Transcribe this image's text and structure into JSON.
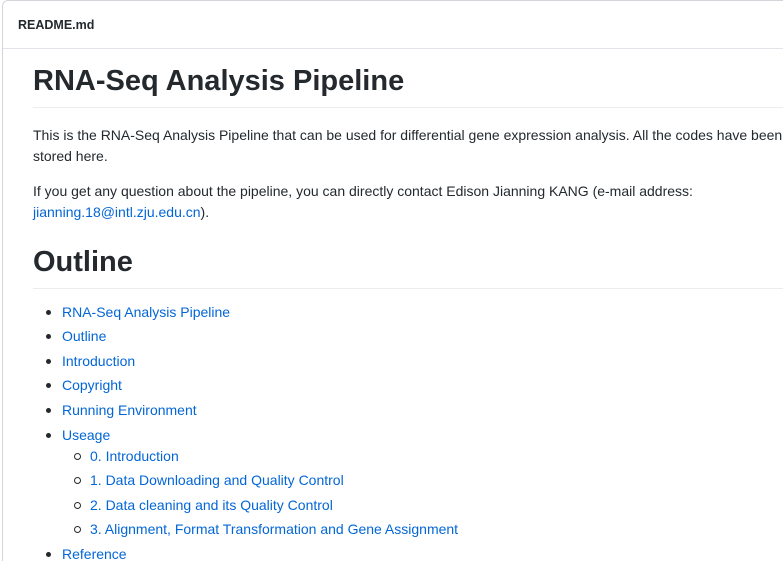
{
  "readme": {
    "filename": "README.md"
  },
  "content": {
    "title": "RNA-Seq Analysis Pipeline",
    "intro": "This is the RNA-Seq Analysis Pipeline that can be used for differential gene expression analysis. All the codes have been stored here.",
    "contact_prefix": "If you get any question about the pipeline, you can directly contact Edison Jianning KANG (e-mail address: ",
    "contact_email": "jianning.18@intl.zju.edu.cn",
    "contact_suffix": ").",
    "outline_heading": "Outline",
    "toc": [
      {
        "label": "RNA-Seq Analysis Pipeline"
      },
      {
        "label": "Outline"
      },
      {
        "label": "Introduction"
      },
      {
        "label": "Copyright"
      },
      {
        "label": "Running Environment"
      },
      {
        "label": "Useage"
      },
      {
        "label": "Reference"
      }
    ],
    "toc_sub": [
      {
        "label": "0. Introduction"
      },
      {
        "label": "1. Data Downloading and Quality Control"
      },
      {
        "label": "2. Data cleaning and its Quality Control"
      },
      {
        "label": "3. Alignment, Format Transformation and Gene Assignment"
      }
    ]
  },
  "colors": {
    "link": "#0366d6",
    "text": "#24292e",
    "border": "#d1d5da"
  }
}
